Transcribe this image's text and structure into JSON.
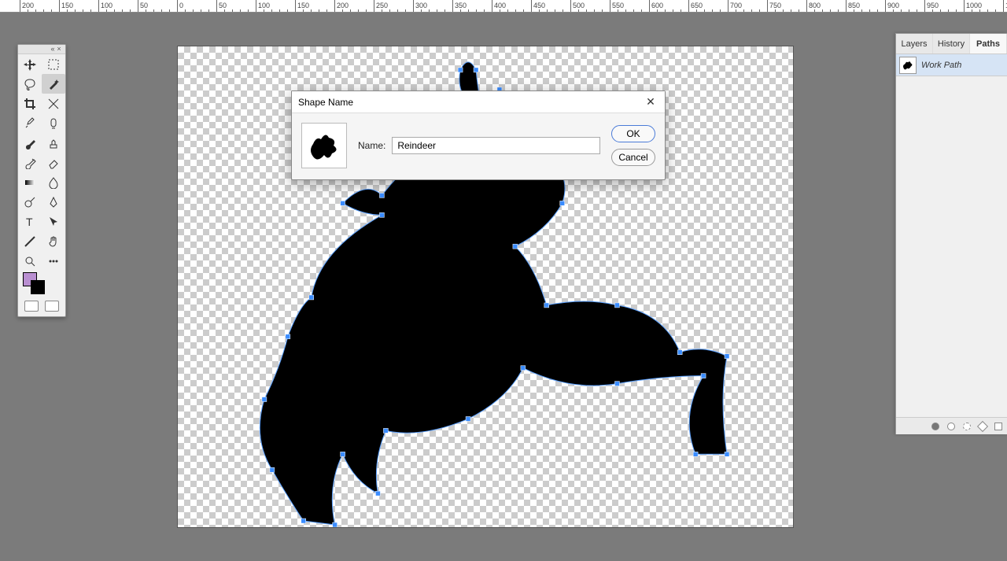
{
  "dialog": {
    "title": "Shape Name",
    "name_label": "Name:",
    "name_value": "Reindeer",
    "ok_label": "OK",
    "cancel_label": "Cancel"
  },
  "panels": {
    "tabs": [
      "Layers",
      "History",
      "Paths"
    ],
    "active_tab": 2,
    "path_item": "Work Path"
  },
  "colors": {
    "foreground": "#b98fd1",
    "background": "#000000"
  },
  "ruler": {
    "start": -200,
    "end": 1050,
    "step": 50
  },
  "tools": [
    "move-tool",
    "rectangular-marquee-tool",
    "lasso-tool",
    "magic-wand-tool",
    "crop-tool",
    "slice-tool",
    "eyedropper-tool",
    "spot-healing-tool",
    "brush-tool",
    "clone-stamp-tool",
    "history-brush-tool",
    "eraser-tool",
    "gradient-tool",
    "blur-tool",
    "dodge-tool",
    "pen-tool",
    "type-tool",
    "path-selection-tool",
    "line-tool",
    "hand-tool",
    "zoom-tool",
    "edit-toolbar"
  ],
  "selected_tool": 3
}
